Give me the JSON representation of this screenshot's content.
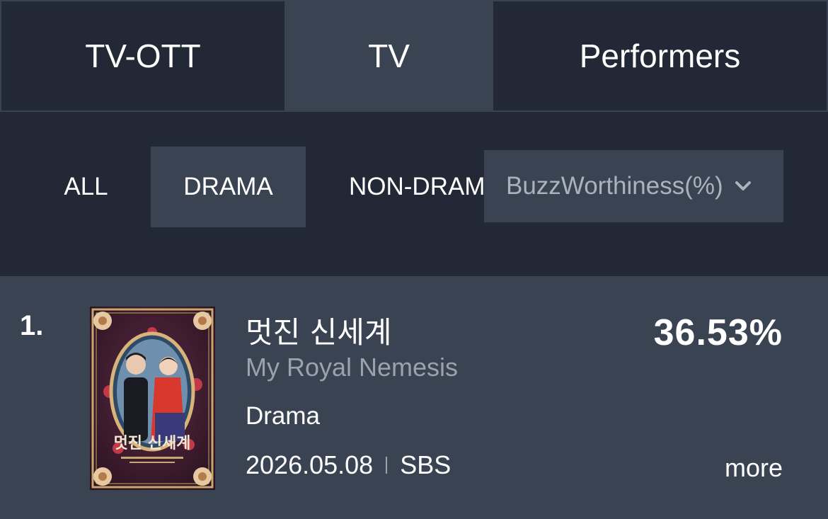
{
  "top_tabs": [
    {
      "label": "TV-OTT",
      "active": false
    },
    {
      "label": "TV",
      "active": true
    },
    {
      "label": "Performers",
      "active": false
    }
  ],
  "filters": [
    {
      "label": "ALL",
      "active": false
    },
    {
      "label": "DRAMA",
      "active": true
    },
    {
      "label": "NON-DRAM",
      "active": false
    }
  ],
  "sort": {
    "selected": "BuzzWorthiness(%)",
    "icon": "chevron-down-icon"
  },
  "item": {
    "rank": "1.",
    "title_ko": "멋진 신세계",
    "title_en": "My Royal Nemesis",
    "genre": "Drama",
    "date": "2026.05.08",
    "channel": "SBS",
    "score": "36.53%",
    "more_label": "more",
    "poster_text": "멋진 신세계"
  },
  "colors": {
    "background": "#222836",
    "active_tab": "#3a4352",
    "secondary_text": "#9aa2b0"
  }
}
